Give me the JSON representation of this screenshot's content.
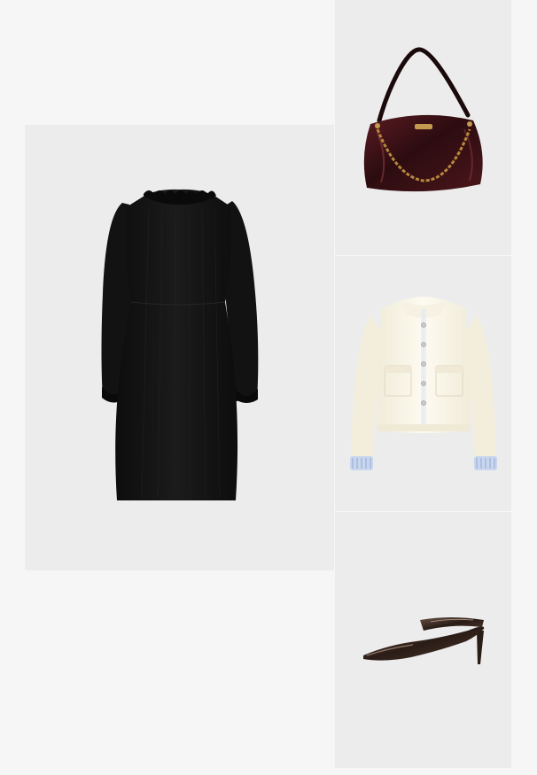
{
  "colors": {
    "page_background": "#f6f6f6",
    "card_background": "#ececec",
    "dress": "#151515",
    "bag_leather": "#3a1214",
    "bag_chain": "#b8893c",
    "jacket": "#fbf8ec",
    "jacket_cuff_stripe": "#9fb6de",
    "shoe_patent": "#3b2a22"
  },
  "products": [
    {
      "id": "dress",
      "icon": "dress-icon"
    },
    {
      "id": "bag",
      "icon": "handbag-icon"
    },
    {
      "id": "jacket",
      "icon": "jacket-icon"
    },
    {
      "id": "shoe",
      "icon": "mule-heel-icon"
    }
  ]
}
